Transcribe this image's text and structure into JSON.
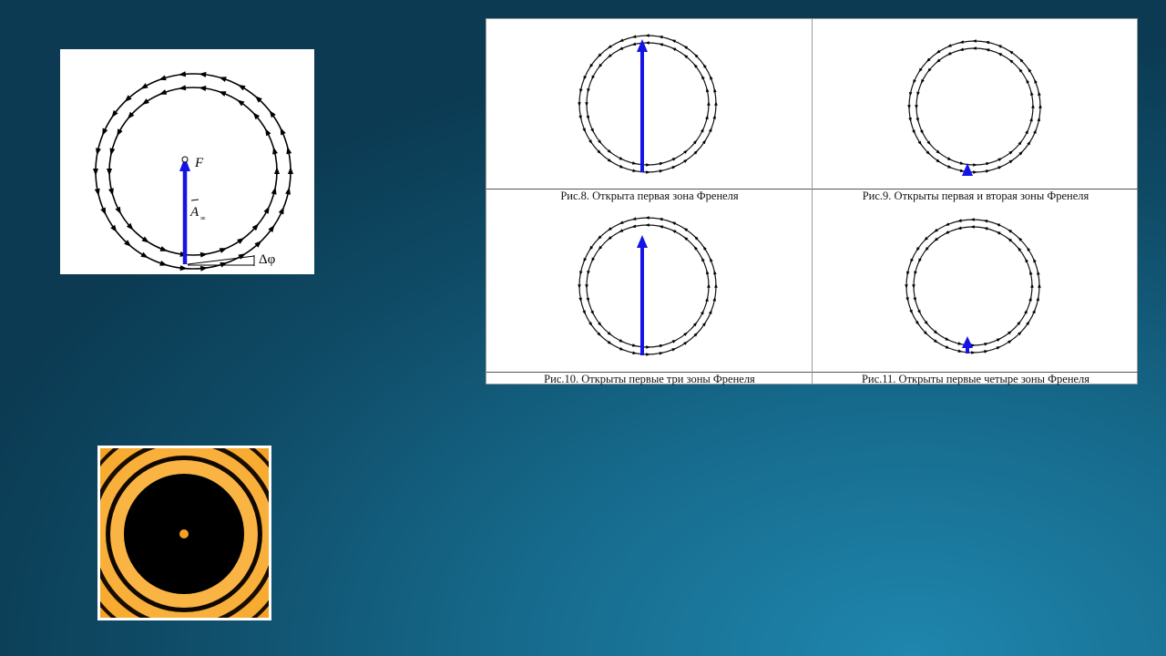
{
  "spiral": {
    "focus_label": "F",
    "amplitude_label": "A",
    "amplitude_subscript": "∞",
    "phase_label": "Δφ"
  },
  "figures": [
    {
      "caption": "Рис.8. Открыта первая зона Френеля"
    },
    {
      "caption": "Рис.9. Открыты первая и вторая зоны Френеля"
    },
    {
      "caption": "Рис.10. Открыты первые три зоны Френеля"
    },
    {
      "caption": "Рис.11. Открыты первые четыре зоны Френеля"
    }
  ],
  "colors": {
    "arrow": "#1414e6",
    "ring_dark": "#000000",
    "ring_light": "#f4a226",
    "background_dark": "#0b3a52",
    "background_light": "#1f86ad"
  }
}
